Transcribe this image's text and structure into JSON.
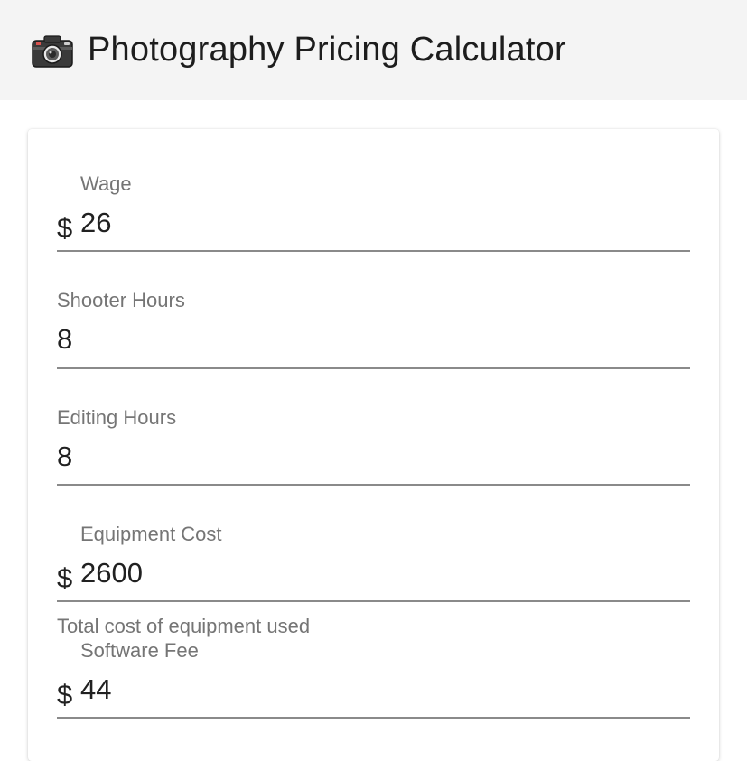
{
  "header": {
    "icon": "camera-icon",
    "title": "Photography Pricing Calculator"
  },
  "form": {
    "wage": {
      "label": "Wage",
      "prefix": "$",
      "value": "26"
    },
    "shooter_hours": {
      "label": "Shooter Hours",
      "value": "8"
    },
    "editing_hours": {
      "label": "Editing Hours",
      "value": "8"
    },
    "equipment_cost": {
      "label": "Equipment Cost",
      "prefix": "$",
      "value": "2600",
      "helper": "Total cost of equipment used"
    },
    "software_fee": {
      "label": "Software Fee",
      "prefix": "$",
      "value": "44"
    }
  },
  "colors": {
    "header_bg": "#f4f4f4",
    "label": "#757575",
    "underline": "#8a8a8a"
  }
}
